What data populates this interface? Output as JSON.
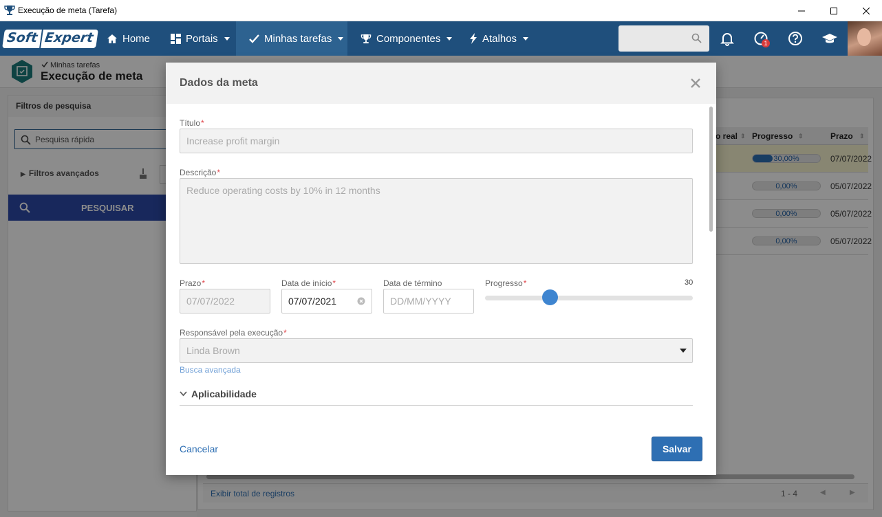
{
  "window": {
    "title": "Execução de meta (Tarefa)"
  },
  "navbar": {
    "logo_left": "Soft",
    "logo_right": "Expert",
    "items": [
      {
        "label": "Home"
      },
      {
        "label": "Portais"
      },
      {
        "label": "Minhas tarefas"
      },
      {
        "label": "Componentes"
      },
      {
        "label": "Atalhos"
      }
    ],
    "notification_count": "1"
  },
  "page": {
    "breadcrumb": "Minhas tarefas",
    "title": "Execução de meta"
  },
  "filters": {
    "title": "Filtros de pesquisa",
    "quick_search_placeholder": "Pesquisa rápida",
    "advanced_label": "Filtros avançados",
    "search_button": "PESQUISAR"
  },
  "grid": {
    "columns": [
      "o real",
      "Progresso",
      "Prazo"
    ],
    "rows": [
      {
        "progress": 30,
        "progress_label": "30,00%",
        "prazo": "07/07/2022",
        "highlight": true
      },
      {
        "progress": 0,
        "progress_label": "0,00%",
        "prazo": "05/07/2022",
        "highlight": false
      },
      {
        "progress": 0,
        "progress_label": "0,00%",
        "prazo": "05/07/2022",
        "highlight": false
      },
      {
        "progress": 0,
        "progress_label": "0,00%",
        "prazo": "05/07/2022",
        "highlight": false
      }
    ],
    "footer_link": "Exibir total de registros",
    "pager_range": "1 - 4"
  },
  "modal": {
    "title": "Dados da meta",
    "titulo_label": "Título",
    "titulo_value": "Increase profit margin",
    "descricao_label": "Descrição",
    "descricao_value": "Reduce operating costs by 10% in 12 months",
    "prazo_label": "Prazo",
    "prazo_value": "07/07/2022",
    "inicio_label": "Data de início",
    "inicio_value": "07/07/2021",
    "termino_label": "Data de término",
    "termino_placeholder": "DD/MM/YYYY",
    "progresso_label": "Progresso",
    "progresso_value": "30",
    "responsavel_label": "Responsável pela execução",
    "responsavel_value": "Linda Brown",
    "busca_link": "Busca avançada",
    "section_label": "Aplicabilidade",
    "cancel_label": "Cancelar",
    "save_label": "Salvar"
  },
  "colors": {
    "navbar": "#1f4f7c",
    "accent": "#2e6fb3",
    "required": "#e0474c"
  }
}
